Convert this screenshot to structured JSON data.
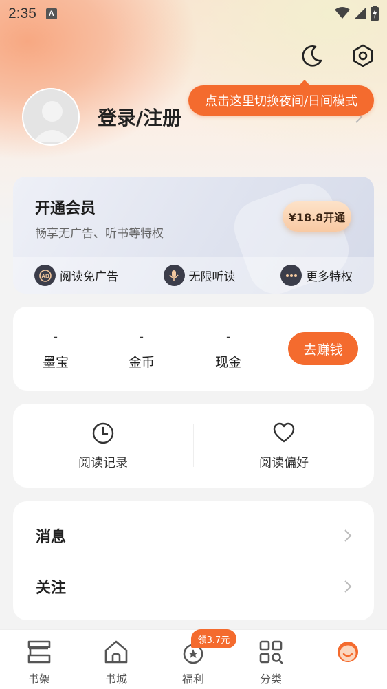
{
  "status_bar": {
    "time": "2:35",
    "notif_glyph": "A",
    "icons": [
      "wifi-icon",
      "signal-icon",
      "battery-icon"
    ]
  },
  "header": {
    "night_mode_icon": "moon-icon",
    "settings_icon": "hexagon-settings-icon",
    "tooltip": "点击这里切换夜间/日间模式"
  },
  "profile": {
    "login_label": "登录/注册",
    "avatar_icon": "default-avatar-icon"
  },
  "vip": {
    "title": "开通会员",
    "subtitle": "畅享无广告、听书等特权",
    "button": "¥18.8开通",
    "features": [
      {
        "icon": "ad-icon",
        "label": "阅读免广告"
      },
      {
        "icon": "microphone-icon",
        "label": "无限听读"
      },
      {
        "icon": "more-dots-icon",
        "label": "更多特权"
      }
    ]
  },
  "wallet": {
    "items": [
      {
        "value": "-",
        "label": "墨宝"
      },
      {
        "value": "-",
        "label": "金币"
      },
      {
        "value": "-",
        "label": "现金"
      }
    ],
    "earn_button": "去赚钱"
  },
  "reading": {
    "history": {
      "icon": "clock-icon",
      "label": "阅读记录"
    },
    "preference": {
      "icon": "heart-icon",
      "label": "阅读偏好"
    }
  },
  "menu": [
    {
      "label": "消息"
    },
    {
      "label": "关注"
    }
  ],
  "tabs": [
    {
      "icon": "bookshelf-icon",
      "label": "书架"
    },
    {
      "icon": "home-icon",
      "label": "书城"
    },
    {
      "icon": "gift-icon",
      "label": "福利"
    },
    {
      "icon": "grid-search-icon",
      "label": "分类"
    },
    {
      "icon": "smiley-face-icon",
      "label": ""
    }
  ],
  "tab_badge": "领3.7元",
  "colors": {
    "accent": "#f46b2e",
    "background": "#f3f3f3",
    "card": "#ffffff"
  }
}
